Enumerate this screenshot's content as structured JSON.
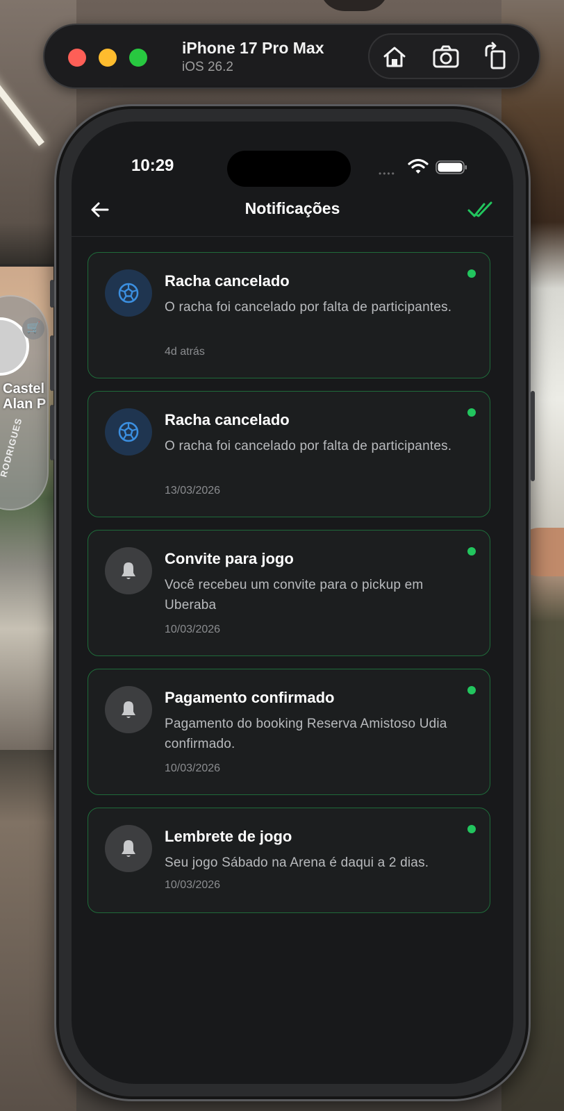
{
  "toolbar": {
    "device_name": "iPhone 17 Pro Max",
    "os_version": "iOS 26.2"
  },
  "background": {
    "map_label": "Castel Alan P",
    "street_label": "RODRIGUES"
  },
  "status_bar": {
    "time": "10:29"
  },
  "nav": {
    "title": "Notificações"
  },
  "colors": {
    "accent": "#22c55e",
    "card_border": "#1f6b3a",
    "screen_bg": "#18191b",
    "ball_icon": "#3b8fe0"
  },
  "notifications": [
    {
      "icon": "soccer-ball-icon",
      "title": "Racha cancelado",
      "body": "O racha foi cancelado por falta de participantes.",
      "time": "4d atrás",
      "unread": true
    },
    {
      "icon": "soccer-ball-icon",
      "title": "Racha cancelado",
      "body": "O racha foi cancelado por falta de participantes.",
      "time": "13/03/2026",
      "unread": true
    },
    {
      "icon": "bell-icon",
      "title": "Convite para jogo",
      "body": "Você recebeu um convite para o pickup em Uberaba",
      "time": "10/03/2026",
      "unread": true
    },
    {
      "icon": "bell-icon",
      "title": "Pagamento confirmado",
      "body": "Pagamento do booking Reserva Amistoso Udia confirmado.",
      "time": "10/03/2026",
      "unread": true
    },
    {
      "icon": "bell-icon",
      "title": "Lembrete de jogo",
      "body": "Seu jogo Sábado na Arena é daqui a 2 dias.",
      "time": "10/03/2026",
      "unread": true
    }
  ]
}
